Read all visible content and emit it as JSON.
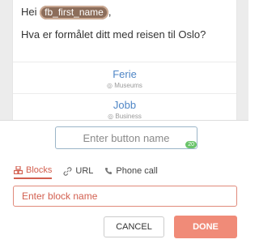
{
  "message": {
    "greeting_prefix": "Hei",
    "variable": "fb_first_name",
    "greeting_suffix": ",",
    "question": "Hva er formålet ditt med reisen til Oslo?"
  },
  "quick_replies": [
    {
      "title": "Ferie",
      "target": "Museums"
    },
    {
      "title": "Jobb",
      "target": "Business"
    }
  ],
  "editor": {
    "button_name_placeholder": "Enter button name",
    "char_counter": "20",
    "tabs": [
      {
        "label": "Blocks",
        "icon": "blocks-icon",
        "active": true
      },
      {
        "label": "URL",
        "icon": "link-icon",
        "active": false
      },
      {
        "label": "Phone call",
        "icon": "phone-icon",
        "active": false
      }
    ],
    "block_name_placeholder": "Enter block name",
    "cancel_label": "CANCEL",
    "done_label": "DONE"
  },
  "colors": {
    "accent": "#d25f4f",
    "done_button": "#f08b78",
    "link_blue": "#4f86c6",
    "variable_pill": "#8c6d5a"
  }
}
